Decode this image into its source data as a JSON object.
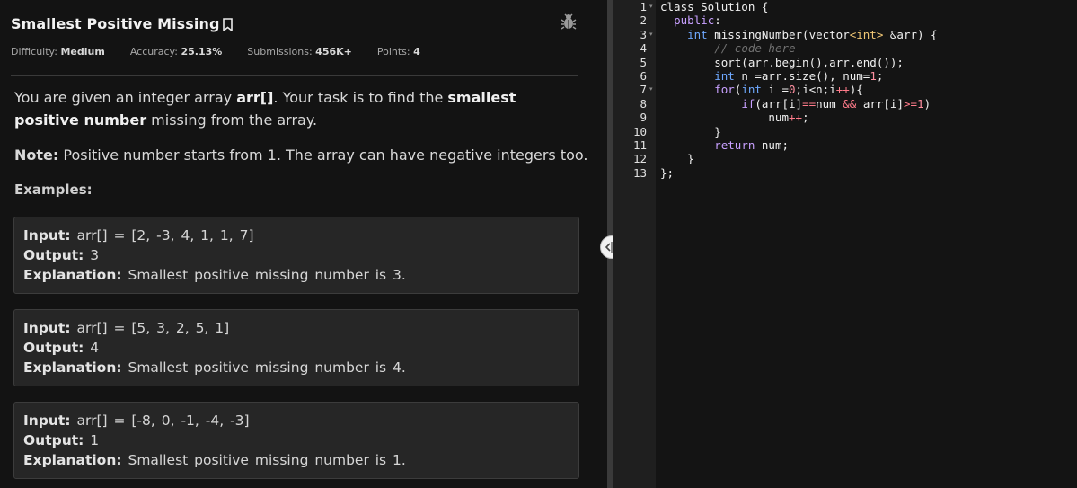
{
  "problem": {
    "title": "Smallest Positive Missing",
    "meta": {
      "difficulty_label": "Difficulty:",
      "difficulty_value": "Medium",
      "accuracy_label": "Accuracy:",
      "accuracy_value": "25.13%",
      "submissions_label": "Submissions:",
      "submissions_value": "456K+",
      "points_label": "Points:",
      "points_value": "4"
    },
    "desc_part1": "You are given an integer array ",
    "desc_bold1": "arr[]",
    "desc_part2": ". Your task is to find the ",
    "desc_bold2": "smallest positive number",
    "desc_part3": " missing from the array.",
    "note_label": "Note:",
    "note_text": " Positive number starts from 1. The array can have negative integers too.",
    "examples_heading": "Examples:",
    "examples": [
      {
        "input_label": "Input:",
        "input": " arr[] = [2, -3, 4, 1, 1, 7]",
        "output_label": "Output:",
        "output": " 3",
        "explanation_label": "Explanation:",
        "explanation": " Smallest positive missing number is 3."
      },
      {
        "input_label": "Input:",
        "input": " arr[] = [5, 3, 2, 5, 1]",
        "output_label": "Output:",
        "output": " 4",
        "explanation_label": "Explanation:",
        "explanation": " Smallest positive missing number is 4."
      },
      {
        "input_label": "Input:",
        "input": " arr[] = [-8, 0, -1, -4, -3]",
        "output_label": "Output:",
        "output": " 1",
        "explanation_label": "Explanation:",
        "explanation": " Smallest positive missing number is 1."
      }
    ]
  },
  "editor": {
    "line_numbers": [
      "1",
      "2",
      "3",
      "4",
      "5",
      "6",
      "7",
      "8",
      "9",
      "10",
      "11",
      "12",
      "13"
    ],
    "lines": [
      [
        {
          "t": "class Solution {",
          "c": ""
        }
      ],
      [
        {
          "t": "  ",
          "c": ""
        },
        {
          "t": "public",
          "c": "kw"
        },
        {
          "t": ":",
          "c": ""
        }
      ],
      [
        {
          "t": "    ",
          "c": ""
        },
        {
          "t": "int",
          "c": "kw2"
        },
        {
          "t": " missingNumber(vector",
          "c": ""
        },
        {
          "t": "<int>",
          "c": "typ"
        },
        {
          "t": " &arr) {",
          "c": ""
        }
      ],
      [
        {
          "t": "        ",
          "c": ""
        },
        {
          "t": "// code here",
          "c": "cm"
        }
      ],
      [
        {
          "t": "        sort(arr.begin(),arr.end());",
          "c": ""
        }
      ],
      [
        {
          "t": "        ",
          "c": ""
        },
        {
          "t": "int",
          "c": "kw2"
        },
        {
          "t": " n =arr.size(), num=",
          "c": ""
        },
        {
          "t": "1",
          "c": "num"
        },
        {
          "t": ";",
          "c": ""
        }
      ],
      [
        {
          "t": "        ",
          "c": ""
        },
        {
          "t": "for",
          "c": "kw"
        },
        {
          "t": "(",
          "c": ""
        },
        {
          "t": "int",
          "c": "kw2"
        },
        {
          "t": " i =",
          "c": ""
        },
        {
          "t": "0",
          "c": "num"
        },
        {
          "t": ";i<n;i",
          "c": ""
        },
        {
          "t": "++",
          "c": "op"
        },
        {
          "t": "){",
          "c": ""
        }
      ],
      [
        {
          "t": "            ",
          "c": ""
        },
        {
          "t": "if",
          "c": "kw"
        },
        {
          "t": "(arr[i]",
          "c": ""
        },
        {
          "t": "==",
          "c": "op"
        },
        {
          "t": "num ",
          "c": ""
        },
        {
          "t": "&&",
          "c": "op"
        },
        {
          "t": " arr[i]",
          "c": ""
        },
        {
          "t": ">=",
          "c": "op"
        },
        {
          "t": "1",
          "c": "num"
        },
        {
          "t": ")",
          "c": ""
        }
      ],
      [
        {
          "t": "                num",
          "c": ""
        },
        {
          "t": "++",
          "c": "op"
        },
        {
          "t": ";",
          "c": ""
        }
      ],
      [
        {
          "t": "        }",
          "c": ""
        }
      ],
      [
        {
          "t": "        ",
          "c": ""
        },
        {
          "t": "return",
          "c": "kw"
        },
        {
          "t": " num;",
          "c": ""
        }
      ],
      [
        {
          "t": "    }",
          "c": ""
        }
      ],
      [
        {
          "t": "};",
          "c": ""
        }
      ]
    ],
    "fold_markers": [
      "▾",
      "",
      "▾",
      "",
      "",
      "",
      "▾",
      "",
      "",
      "",
      "",
      "",
      ""
    ]
  }
}
